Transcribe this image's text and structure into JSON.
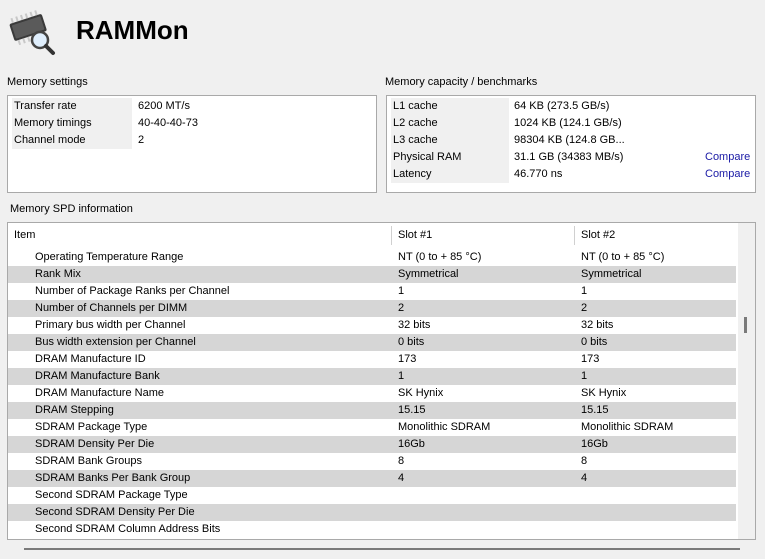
{
  "app": {
    "title": "RAMMon"
  },
  "memory_settings": {
    "label": "Memory settings",
    "rows": [
      {
        "key": "Transfer rate",
        "value": "6200 MT/s"
      },
      {
        "key": "Memory timings",
        "value": "40-40-40-73"
      },
      {
        "key": "Channel mode",
        "value": "2"
      }
    ]
  },
  "capacity": {
    "label": "Memory capacity / benchmarks",
    "rows": [
      {
        "key": "L1 cache",
        "value": "64 KB (273.5 GB/s)",
        "link": ""
      },
      {
        "key": "L2 cache",
        "value": "1024 KB (124.1 GB/s)",
        "link": ""
      },
      {
        "key": "L3 cache",
        "value": "98304 KB (124.8 GB...",
        "link": ""
      },
      {
        "key": "Physical RAM",
        "value": "31.1 GB (34383 MB/s)",
        "link": "Compare"
      },
      {
        "key": "Latency",
        "value": "46.770 ns",
        "link": "Compare"
      }
    ]
  },
  "spd": {
    "label": "Memory SPD information",
    "columns": [
      "Item",
      "Slot #1",
      "Slot #2"
    ],
    "rows": [
      [
        "Operating Temperature Range",
        "NT (0 to + 85 °C)",
        "NT (0 to + 85 °C)"
      ],
      [
        "Rank Mix",
        "Symmetrical",
        "Symmetrical"
      ],
      [
        "Number of Package Ranks per Channel",
        "1",
        "1"
      ],
      [
        "Number of Channels per DIMM",
        "2",
        "2"
      ],
      [
        "Primary bus width per Channel",
        "32 bits",
        "32 bits"
      ],
      [
        "Bus width extension per Channel",
        "0 bits",
        "0 bits"
      ],
      [
        "DRAM Manufacture ID",
        "173",
        "173"
      ],
      [
        "DRAM Manufacture Bank",
        "1",
        "1"
      ],
      [
        "DRAM Manufacture Name",
        "SK Hynix",
        "SK Hynix"
      ],
      [
        "DRAM Stepping",
        "15.15",
        "15.15"
      ],
      [
        "SDRAM Package Type",
        "Monolithic SDRAM",
        "Monolithic SDRAM"
      ],
      [
        "SDRAM Density Per Die",
        "16Gb",
        "16Gb"
      ],
      [
        "SDRAM Bank Groups",
        "8",
        "8"
      ],
      [
        "SDRAM Banks Per Bank Group",
        "4",
        "4"
      ],
      [
        "Second SDRAM Package Type",
        "",
        ""
      ],
      [
        "Second SDRAM Density Per Die",
        "",
        ""
      ],
      [
        "Second SDRAM Column Address Bits",
        "",
        ""
      ]
    ],
    "scroll_position": 0.3
  },
  "icons": {
    "app_icon": "memory-chip-magnifier-icon"
  }
}
